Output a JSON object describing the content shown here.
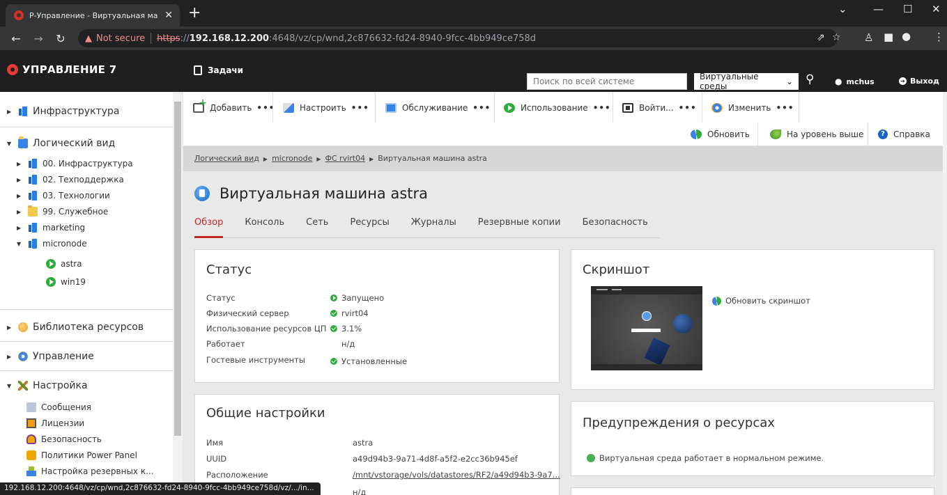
{
  "browser": {
    "tab_title": "Р-Управление - Виртуальная ма",
    "close_glyph": "✕",
    "new_tab_glyph": "+",
    "not_secure": "Not secure",
    "url_scheme": "https",
    "url_rest_prefix": "://",
    "url_host": "192.168.12.200",
    "url_path": ":4648/vz/cp/wnd,2c876632-fd24-8940-9fcc-4bb949ce758d",
    "status_url": "192.168.12.200:4648/vz/cp/wnd,2c876632-fd24-8940-9fcc-4bb949ce758d/vz/.../in..."
  },
  "header": {
    "logo_text": "УПРАВЛЕНИЕ 7",
    "tasks_label": "Задачи",
    "search_placeholder": "Поиск по всей системе",
    "env_select": "Виртуальные среды",
    "user_name": "mchus",
    "logout_label": "Выход"
  },
  "sidebar": {
    "infrastructure": "Инфраструктура",
    "logical_view": "Логический вид",
    "logical_children": [
      "00. Инфраструктура",
      "02. Техподдержка",
      "03. Технологии",
      "99. Служебное",
      "marketing",
      "micronode"
    ],
    "vms": [
      "astra",
      "win19"
    ],
    "library": "Библиотека ресурсов",
    "management": "Управление",
    "settings": "Настройка",
    "settings_children": [
      "Сообщения",
      "Лицензии",
      "Безопасность",
      "Политики Power Panel",
      "Настройка резервных к..."
    ]
  },
  "toolbar": {
    "add": "Добавить",
    "configure": "Настроить",
    "service": "Обслуживание",
    "usage": "Использование",
    "login": "Войти...",
    "change": "Изменить",
    "dots": "•••",
    "refresh": "Обновить",
    "level_up": "На уровень выше",
    "help": "Справка"
  },
  "breadcrumb": {
    "items": [
      "Логический вид",
      "micronode",
      "ФС rvirt04"
    ],
    "current": "Виртуальная машина astra"
  },
  "vm": {
    "title": "Виртуальная машина astra",
    "tabs": [
      "Обзор",
      "Консоль",
      "Сеть",
      "Ресурсы",
      "Журналы",
      "Резервные копии",
      "Безопасность"
    ]
  },
  "status_panel": {
    "title": "Статус",
    "rows": [
      {
        "label": "Статус",
        "value": "Запущено"
      },
      {
        "label": "Физический сервер",
        "value": "rvirt04"
      },
      {
        "label": "Использование ресурсов ЦП",
        "value": "3.1%"
      },
      {
        "label": "Работает",
        "value": "н/д"
      },
      {
        "label": "Гостевые инструменты",
        "value": "Установленные"
      }
    ]
  },
  "general_panel": {
    "title": "Общие настройки",
    "rows": [
      {
        "label": "Имя",
        "value": "astra"
      },
      {
        "label": "UUID",
        "value": "a49d94b3-9a71-4d8f-a5f2-e2cc36b945ef"
      },
      {
        "label": "Расположение",
        "value": "/mnt/vstorage/vols/datastores/RF2/a49d94b3-9a7..."
      },
      {
        "label": "",
        "value": "н/д"
      }
    ]
  },
  "screenshot_panel": {
    "title": "Скриншот",
    "refresh_label": "Обновить скриншот"
  },
  "alerts_panel": {
    "title": "Предупреждения о ресурсах",
    "message": "Виртуальная среда работает в нормальном режиме."
  },
  "colors": {
    "accent_red": "#c62828",
    "header_bg": "#1f1f1f",
    "ok_green": "#2eab3c"
  }
}
